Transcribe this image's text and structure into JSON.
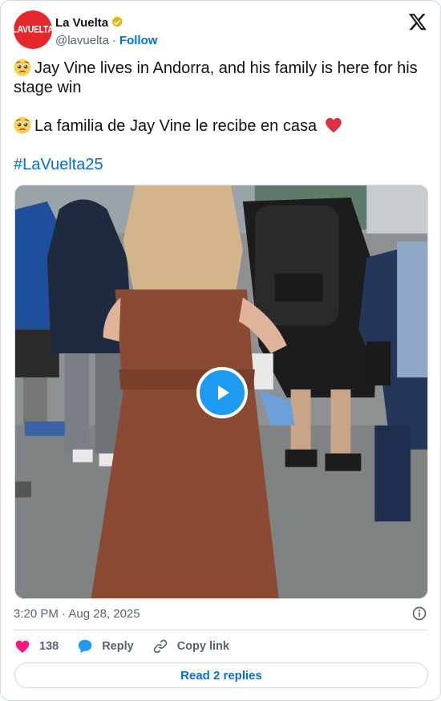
{
  "account": {
    "display_name": "La Vuelta",
    "handle": "@lavuelta",
    "separator": "·",
    "follow_label": "Follow",
    "avatar_text": "LAVUELTA",
    "avatar_color": "#e4282c",
    "verified_badge": "gold-verified-icon"
  },
  "post": {
    "line1": "Jay Vine lives in Andorra, and his family is here for his stage win",
    "line2": "La familia de Jay Vine le recibe en casa",
    "hashtag": "#LaVuelta25",
    "emoji1": "pleading-face-emoji",
    "emoji2": "pleading-face-emoji",
    "heart_emoji": "red-heart-emoji"
  },
  "media": {
    "type": "video",
    "play_icon": "play-icon"
  },
  "meta": {
    "timestamp": "3:20 PM · Aug 28, 2025"
  },
  "actions": {
    "like_count": "138",
    "reply_label": "Reply",
    "copy_label": "Copy link"
  },
  "footer": {
    "read_replies_label": "Read 2 replies"
  },
  "colors": {
    "accent": "#1d9bf0",
    "link": "#006fd6",
    "like": "#f91880",
    "muted": "#536471",
    "border": "#cfd9de"
  }
}
